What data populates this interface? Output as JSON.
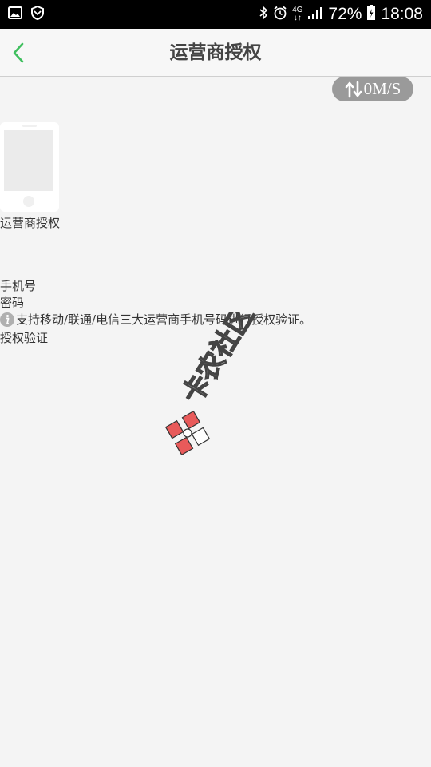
{
  "status_bar": {
    "network": "4G",
    "battery": "72%",
    "time": "18:08",
    "icons": [
      "gallery-icon",
      "shield-icon",
      "bluetooth-icon",
      "alarm-icon",
      "signal-icon",
      "battery-icon"
    ]
  },
  "header": {
    "title": "运营商授权",
    "back_icon": "chevron-left-icon",
    "accent_color": "#3fbf5e"
  },
  "speed_badge": {
    "value": "0M/S",
    "icon": "transfer-arrows-icon"
  },
  "main": {
    "image_icon": "phone-icon",
    "image_label": "运营商授权",
    "phone_label": "手机号",
    "password_label": "密码",
    "info_icon": "info-icon",
    "info_text": "支持移动/联通/电信三大运营商手机号码进行授权验证。",
    "verify_label": "授权验证"
  },
  "watermark": {
    "text": "卡农社区"
  }
}
